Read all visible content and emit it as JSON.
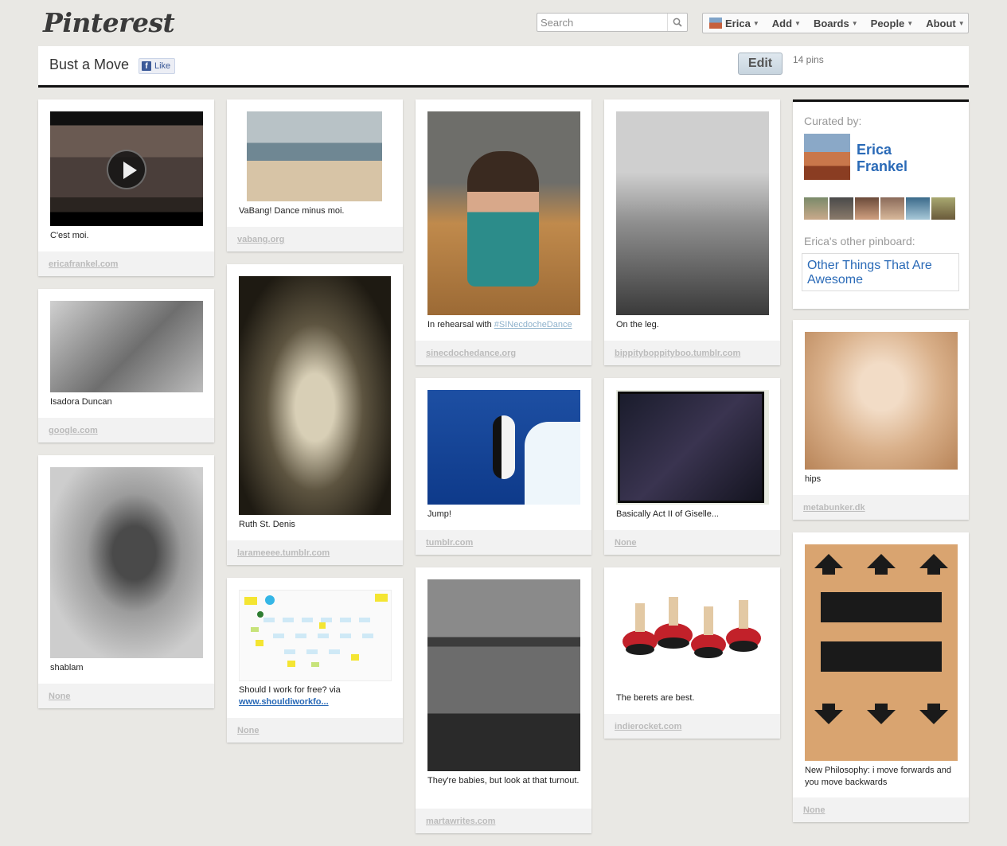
{
  "app": {
    "logo": "Pinterest"
  },
  "search": {
    "placeholder": "Search",
    "value": ""
  },
  "nav": {
    "user": "Erica",
    "add": "Add",
    "boards": "Boards",
    "people": "People",
    "about": "About"
  },
  "board": {
    "title": "Bust a Move",
    "like_label": "Like",
    "edit_label": "Edit",
    "pin_count": "14 pins"
  },
  "curator": {
    "label": "Curated by:",
    "first_name": "Erica",
    "last_name": "Frankel",
    "other_label": "Erica's other pinboard:",
    "other_board": "Other Things That Are Awesome"
  },
  "pins": [
    {
      "desc": "C'est moi.",
      "source": "ericafrankel.com"
    },
    {
      "desc": "Isadora Duncan",
      "source": "google.com"
    },
    {
      "desc": "shablam",
      "source": "None"
    },
    {
      "desc": "VaBang! Dance minus moi.",
      "source": "vabang.org"
    },
    {
      "desc": "Ruth St. Denis",
      "source": "larameeee.tumblr.com"
    },
    {
      "desc": "Should I work for free? via",
      "link": "www.shouldiworkfo...",
      "source": "None"
    },
    {
      "desc": "In rehearsal with ",
      "hashtag": "#SINecdocheDance",
      "source": "sinecdochedance.org"
    },
    {
      "desc": "Jump!",
      "source": "tumblr.com"
    },
    {
      "desc": "They're babies, but look at that turnout.",
      "source": "martawrites.com"
    },
    {
      "desc": "On the leg.",
      "source": "bippityboppityboo.tumblr.com"
    },
    {
      "desc": "Basically Act II of Giselle...",
      "source": "None"
    },
    {
      "desc": "The berets are best.",
      "source": "indierocket.com"
    },
    {
      "desc": "hips",
      "source": "metabunker.dk"
    },
    {
      "desc": "New Philosophy: i move forwards and you move backwards",
      "source": "None"
    }
  ]
}
